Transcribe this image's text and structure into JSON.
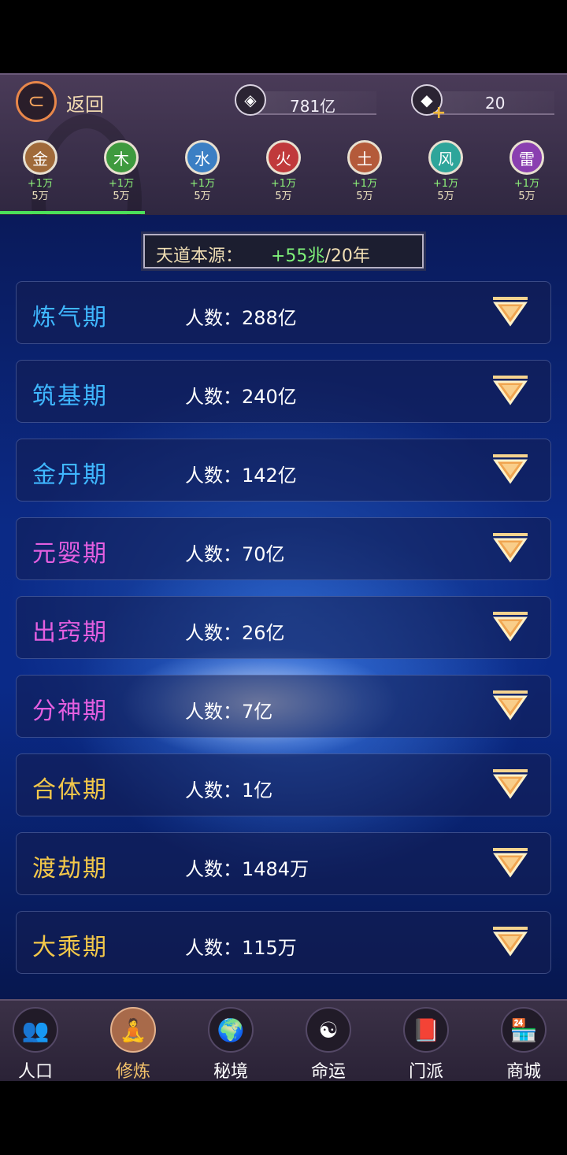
{
  "header": {
    "back_label": "返回",
    "resources": [
      {
        "icon": "spirit-stone-icon",
        "value": "781亿"
      },
      {
        "icon": "diamond-icon",
        "value": "20"
      }
    ]
  },
  "elements": [
    {
      "char": "金",
      "gain": "+1万",
      "total": "5万",
      "color": "#a06a3a"
    },
    {
      "char": "木",
      "gain": "+1万",
      "total": "5万",
      "color": "#3e9a3e"
    },
    {
      "char": "水",
      "gain": "+1万",
      "total": "5万",
      "color": "#3b7fc4"
    },
    {
      "char": "火",
      "gain": "+1万",
      "total": "5万",
      "color": "#c0393b"
    },
    {
      "char": "土",
      "gain": "+1万",
      "total": "5万",
      "color": "#b45a3a"
    },
    {
      "char": "风",
      "gain": "+1万",
      "total": "5万",
      "color": "#2ea59a"
    },
    {
      "char": "雷",
      "gain": "+1万",
      "total": "5万",
      "color": "#8a3fb0"
    }
  ],
  "source": {
    "label": "天道本源：",
    "value": "+55兆",
    "period": "/20年"
  },
  "stages": [
    {
      "name": "炼气期",
      "count": "人数：288亿",
      "color": "#3fb7ff"
    },
    {
      "name": "筑基期",
      "count": "人数：240亿",
      "color": "#3fb7ff"
    },
    {
      "name": "金丹期",
      "count": "人数：142亿",
      "color": "#3fb7ff"
    },
    {
      "name": "元婴期",
      "count": "人数：70亿",
      "color": "#e45fe0"
    },
    {
      "name": "出窍期",
      "count": "人数：26亿",
      "color": "#e45fe0"
    },
    {
      "name": "分神期",
      "count": "人数：7亿",
      "color": "#e45fe0"
    },
    {
      "name": "合体期",
      "count": "人数：1亿",
      "color": "#f3c84a"
    },
    {
      "name": "渡劫期",
      "count": "人数：1484万",
      "color": "#f3c84a"
    },
    {
      "name": "大乘期",
      "count": "人数：115万",
      "color": "#f3c84a"
    }
  ],
  "nav": [
    {
      "label": "人口",
      "icon": "people-icon",
      "glyph": "👥",
      "active": false
    },
    {
      "label": "修炼",
      "icon": "meditation-icon",
      "glyph": "🧘",
      "active": true
    },
    {
      "label": "秘境",
      "icon": "globe-icon",
      "glyph": "🌍",
      "active": false
    },
    {
      "label": "命运",
      "icon": "yin-yang-icon",
      "glyph": "☯",
      "active": false
    },
    {
      "label": "门派",
      "icon": "sect-book-icon",
      "glyph": "📕",
      "active": false
    },
    {
      "label": "商城",
      "icon": "shop-icon",
      "glyph": "🏪",
      "active": false
    }
  ]
}
